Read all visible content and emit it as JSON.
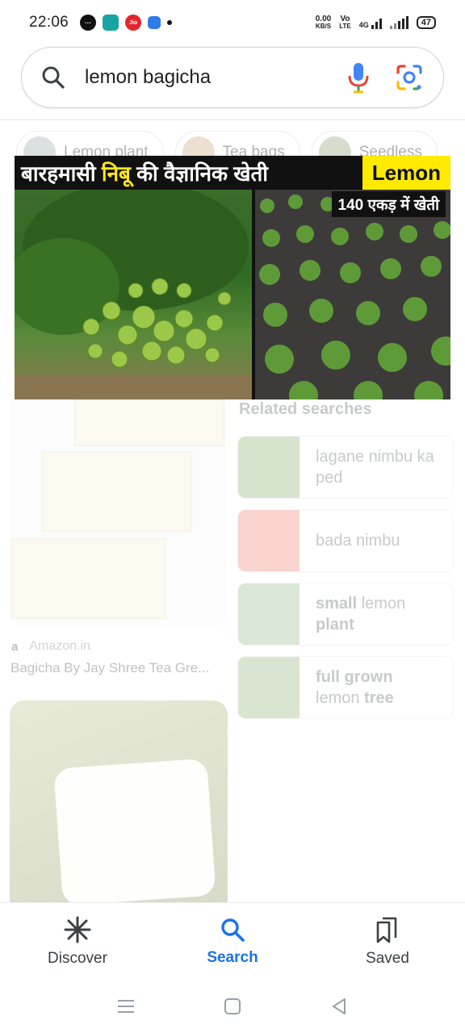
{
  "status_bar": {
    "time": "22:06",
    "net_speed_value": "0.00",
    "net_speed_unit": "KB/S",
    "volte_top": "Vo",
    "volte_bottom": "LTE",
    "network": "4G",
    "battery": "47",
    "jio_label": "Jio"
  },
  "search": {
    "query": "lemon bagicha",
    "search_icon": "search-icon",
    "mic_icon": "mic-icon",
    "lens_icon": "google-lens-icon"
  },
  "chips": [
    {
      "label": "Lemon plant"
    },
    {
      "label": "Tea bags"
    },
    {
      "label": "Seedless"
    }
  ],
  "video_overlay": {
    "title_part1": "बारहमासी ",
    "title_highlight": "निबू",
    "title_part2": " की वैज्ञानिक खेती",
    "tag": "Lemon",
    "subtitle": "140 एकड़ में खेती"
  },
  "results": {
    "product": {
      "source": "Amazon.in",
      "source_logo": "a",
      "title": "Bagicha By Jay Shree Tea Gre..."
    },
    "related_title": "Related searches",
    "related": [
      {
        "plain": "lagane nimbu ka ped",
        "bold1": "",
        "mid": "",
        "bold2": ""
      },
      {
        "plain": "bada nimbu",
        "bold1": "",
        "mid": "",
        "bold2": ""
      },
      {
        "plain": "",
        "bold1": "small",
        "mid": " lemon ",
        "bold2": "plant"
      },
      {
        "plain": "",
        "bold1": "full grown",
        "mid": " lemon ",
        "bold2": "tree"
      }
    ]
  },
  "bottom_nav": {
    "discover": "Discover",
    "search": "Search",
    "saved": "Saved"
  },
  "colors": {
    "accent": "#1a73e8",
    "title_yellow": "#ffe81a",
    "tag_yellow": "#ffea00"
  }
}
